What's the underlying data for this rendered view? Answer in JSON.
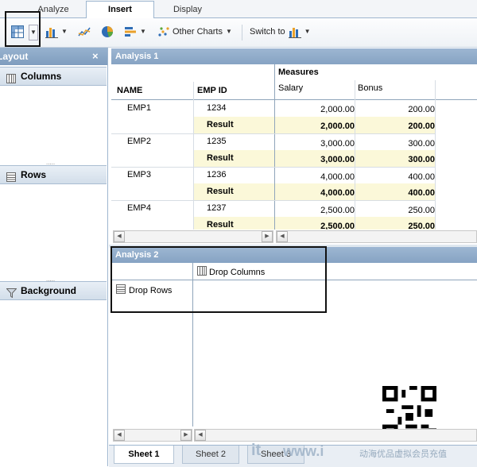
{
  "tabs": [
    {
      "label": "Analyze"
    },
    {
      "label": "Insert"
    },
    {
      "label": "Display"
    }
  ],
  "toolbar": {
    "other_charts_label": "Other Charts",
    "switch_to_label": "Switch to"
  },
  "layout_panel": {
    "title": "Layout",
    "close_glyph": "×",
    "sections": [
      {
        "label": "Columns",
        "icon": "columns-icon"
      },
      {
        "label": "Rows",
        "icon": "rows-icon"
      },
      {
        "label": "Background",
        "icon": "filter-icon"
      }
    ]
  },
  "analysis1": {
    "title": "Analysis 1",
    "measures_label": "Measures",
    "col_name": "NAME",
    "col_empid": "EMP ID",
    "col_salary": "Salary",
    "col_bonus": "Bonus",
    "rows": [
      {
        "name": "EMP1",
        "id": "1234",
        "salary": "2,000.00",
        "bonus": "200.00",
        "result_label": "Result",
        "r_salary": "2,000.00",
        "r_bonus": "200.00"
      },
      {
        "name": "EMP2",
        "id": "1235",
        "salary": "3,000.00",
        "bonus": "300.00",
        "result_label": "Result",
        "r_salary": "3,000.00",
        "r_bonus": "300.00"
      },
      {
        "name": "EMP3",
        "id": "1236",
        "salary": "4,000.00",
        "bonus": "400.00",
        "result_label": "Result",
        "r_salary": "4,000.00",
        "r_bonus": "400.00"
      },
      {
        "name": "EMP4",
        "id": "1237",
        "salary": "2,500.00",
        "bonus": "250.00",
        "result_label": "Result",
        "r_salary": "2,500.00",
        "r_bonus": "250.00"
      }
    ]
  },
  "analysis2": {
    "title": "Analysis 2",
    "drop_columns": "Drop Columns",
    "drop_rows": "Drop Rows"
  },
  "sheets": [
    {
      "label": "Sheet 1"
    },
    {
      "label": "Sheet 2"
    },
    {
      "label": "Sheet 3"
    }
  ],
  "watermark": {
    "left_text": "it",
    "url_text": "www.i",
    "cn_text": "动海优品虚拟会员充值"
  },
  "colors": {
    "accent": "#86a3c3",
    "result_bg": "#fbf8d9"
  }
}
